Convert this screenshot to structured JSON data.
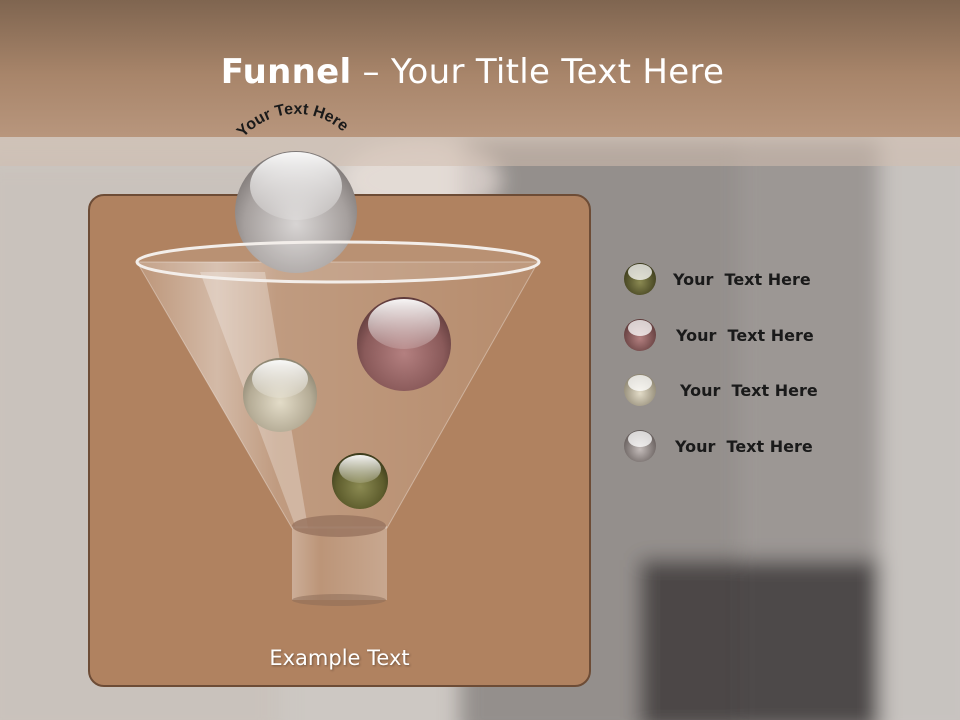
{
  "title": {
    "bold": "Funnel",
    "rest": " – Your Title Text Here"
  },
  "funnel": {
    "top_label": "Your Text Here",
    "bottom_label": "Example Text"
  },
  "legend": [
    {
      "label": "Your  Text Here",
      "color": "#5e5d2d"
    },
    {
      "label": "Your  Text Here",
      "color": "#8a5a5a"
    },
    {
      "label": "Your  Text Here",
      "color": "#b5ac96"
    },
    {
      "label": "Your  Text Here",
      "color": "#8c8482"
    }
  ],
  "colors": {
    "header": "#a8856a",
    "panel": "#b08260",
    "panel_border": "#6d4c36"
  }
}
